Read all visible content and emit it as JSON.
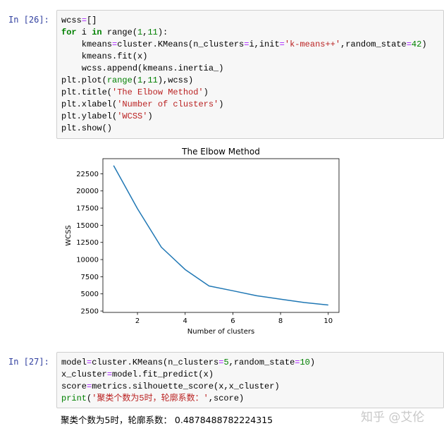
{
  "cells": [
    {
      "prompt": "In  [26]:",
      "lines": [
        [
          {
            "t": "wcss"
          },
          {
            "t": "=",
            "c": "op"
          },
          {
            "t": "[]"
          }
        ],
        [
          {
            "t": "for",
            "c": "kw"
          },
          {
            "t": " i "
          },
          {
            "t": "in",
            "c": "kw"
          },
          {
            "t": " range("
          },
          {
            "t": "1",
            "c": "num"
          },
          {
            "t": ","
          },
          {
            "t": "11",
            "c": "num"
          },
          {
            "t": "):"
          }
        ],
        [
          {
            "t": "    kmeans"
          },
          {
            "t": "=",
            "c": "op"
          },
          {
            "t": "cluster.KMeans(n_clusters"
          },
          {
            "t": "=",
            "c": "op"
          },
          {
            "t": "i,init"
          },
          {
            "t": "=",
            "c": "op"
          },
          {
            "t": "'k-means++'",
            "c": "str"
          },
          {
            "t": ",random_state"
          },
          {
            "t": "=",
            "c": "op"
          },
          {
            "t": "42",
            "c": "num"
          },
          {
            "t": ")"
          }
        ],
        [
          {
            "t": "    kmeans.fit(x)"
          }
        ],
        [
          {
            "t": "    wcss.append(kmeans.inertia_)"
          }
        ],
        [
          {
            "t": "plt.plot("
          },
          {
            "t": "range",
            "c": "bi"
          },
          {
            "t": "("
          },
          {
            "t": "1",
            "c": "num"
          },
          {
            "t": ","
          },
          {
            "t": "11",
            "c": "num"
          },
          {
            "t": "),wcss)"
          }
        ],
        [
          {
            "t": "plt.title("
          },
          {
            "t": "'The Elbow Method'",
            "c": "str"
          },
          {
            "t": ")"
          }
        ],
        [
          {
            "t": "plt.xlabel("
          },
          {
            "t": "'Number of clusters'",
            "c": "str"
          },
          {
            "t": ")"
          }
        ],
        [
          {
            "t": "plt.ylabel("
          },
          {
            "t": "'WCSS'",
            "c": "str"
          },
          {
            "t": ")"
          }
        ],
        [
          {
            "t": "plt.show()"
          }
        ]
      ]
    },
    {
      "prompt": "In  [27]:",
      "lines": [
        [
          {
            "t": "model"
          },
          {
            "t": "=",
            "c": "op"
          },
          {
            "t": "cluster.KMeans(n_clusters"
          },
          {
            "t": "=",
            "c": "op"
          },
          {
            "t": "5",
            "c": "num"
          },
          {
            "t": ",random_state"
          },
          {
            "t": "=",
            "c": "op"
          },
          {
            "t": "10",
            "c": "num"
          },
          {
            "t": ")"
          }
        ],
        [
          {
            "t": "x_cluster"
          },
          {
            "t": "=",
            "c": "op"
          },
          {
            "t": "model.fit_predict(x)"
          }
        ],
        [
          {
            "t": "score"
          },
          {
            "t": "=",
            "c": "op"
          },
          {
            "t": "metrics.silhouette_score(x,x_cluster)"
          }
        ],
        [
          {
            "t": "print",
            "c": "bi"
          },
          {
            "t": "("
          },
          {
            "t": "'聚类个数为5时，轮廓系数：'",
            "c": "str"
          },
          {
            "t": ",score)"
          }
        ]
      ],
      "output": "聚类个数为5时，轮廓系数： 0.4878488782224315"
    }
  ],
  "watermark": "知乎 @艾伦",
  "chart_data": {
    "type": "line",
    "title": "The Elbow Method",
    "xlabel": "Number of clusters",
    "ylabel": "WCSS",
    "x": [
      1,
      2,
      3,
      4,
      5,
      6,
      7,
      8,
      9,
      10
    ],
    "series": [
      {
        "name": "wcss",
        "color": "#1f77b4",
        "values": [
          23700,
          17400,
          11800,
          8550,
          6150,
          5450,
          4720,
          4230,
          3740,
          3380
        ]
      }
    ],
    "xlim": [
      0.55,
      10.45
    ],
    "ylim": [
      2300,
      24700
    ],
    "xticks": [
      2,
      4,
      6,
      8,
      10
    ],
    "yticks": [
      2500,
      5000,
      7500,
      10000,
      12500,
      15000,
      17500,
      20000,
      22500
    ],
    "grid": false
  }
}
